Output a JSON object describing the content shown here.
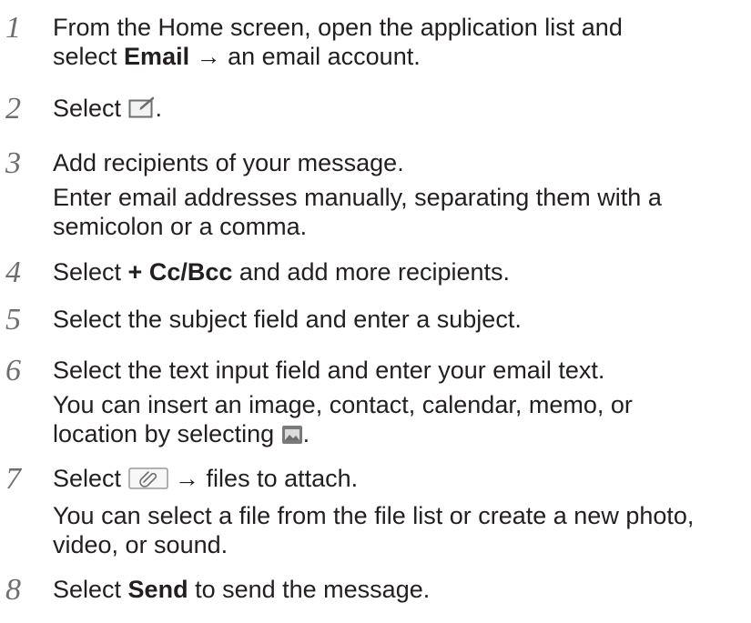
{
  "steps": [
    {
      "num": "1",
      "lines": [
        {
          "parts": [
            "From the Home screen, open the application list and"
          ]
        },
        {
          "parts": [
            "select ",
            "Email",
            " → an email account."
          ]
        }
      ]
    },
    {
      "num": "2",
      "lines": [
        {
          "parts": [
            "Select ",
            "."
          ],
          "icon": "compose-icon"
        }
      ]
    },
    {
      "num": "3",
      "lines": [
        {
          "parts": [
            "Add recipients of your message."
          ]
        },
        {
          "parts": [
            "Enter email addresses manually, separating them with a"
          ]
        },
        {
          "parts": [
            "semicolon or a comma."
          ]
        }
      ]
    },
    {
      "num": "4",
      "lines": [
        {
          "parts": [
            "Select ",
            "+ Cc/Bcc",
            " and add more recipients."
          ]
        }
      ]
    },
    {
      "num": "5",
      "lines": [
        {
          "parts": [
            "Select the subject field and enter a subject."
          ]
        }
      ]
    },
    {
      "num": "6",
      "lines": [
        {
          "parts": [
            "Select the text input field and enter your email text."
          ]
        },
        {
          "parts": [
            "You can insert an image, contact, calendar, memo, or"
          ]
        },
        {
          "parts": [
            "location by selecting ",
            "."
          ],
          "icon": "image-icon"
        }
      ]
    },
    {
      "num": "7",
      "lines": [
        {
          "parts": [
            "Select ",
            " → files to attach."
          ],
          "icon": "attach-icon"
        },
        {
          "parts": [
            "You can select a file from the file list or create a new photo,"
          ]
        },
        {
          "parts": [
            "video, or sound."
          ]
        }
      ]
    },
    {
      "num": "8",
      "lines": [
        {
          "parts": [
            "Select ",
            "Send",
            " to send the message."
          ]
        }
      ]
    }
  ]
}
